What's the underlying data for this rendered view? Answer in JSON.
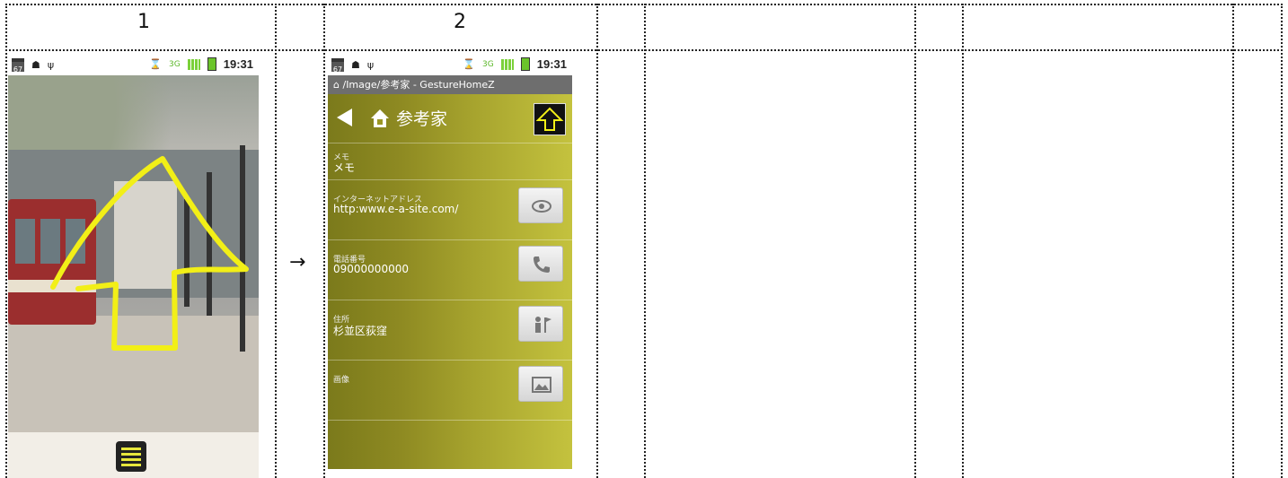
{
  "columns": {
    "c1": "1",
    "c2": "2"
  },
  "transition_arrow": "→",
  "screen1": {
    "status": {
      "calendar_day": "67",
      "time": "19:31"
    }
  },
  "screen2": {
    "status": {
      "calendar_day": "67",
      "time": "19:31"
    },
    "title_bar": "/Image/参考家 - GestureHomeZ",
    "header_title": "参考家",
    "fields": [
      {
        "label": "メモ",
        "value": "メモ"
      },
      {
        "label": "インターネットアドレス",
        "value": "http:www.e-a-site.com/"
      },
      {
        "label": "電話番号",
        "value": "09000000000"
      },
      {
        "label": "住所",
        "value": "杉並区荻窪"
      },
      {
        "label": "画像",
        "value": ""
      }
    ]
  },
  "colors": {
    "gesture_stroke": "#f2ef17",
    "app_green": "#a7a42e"
  }
}
